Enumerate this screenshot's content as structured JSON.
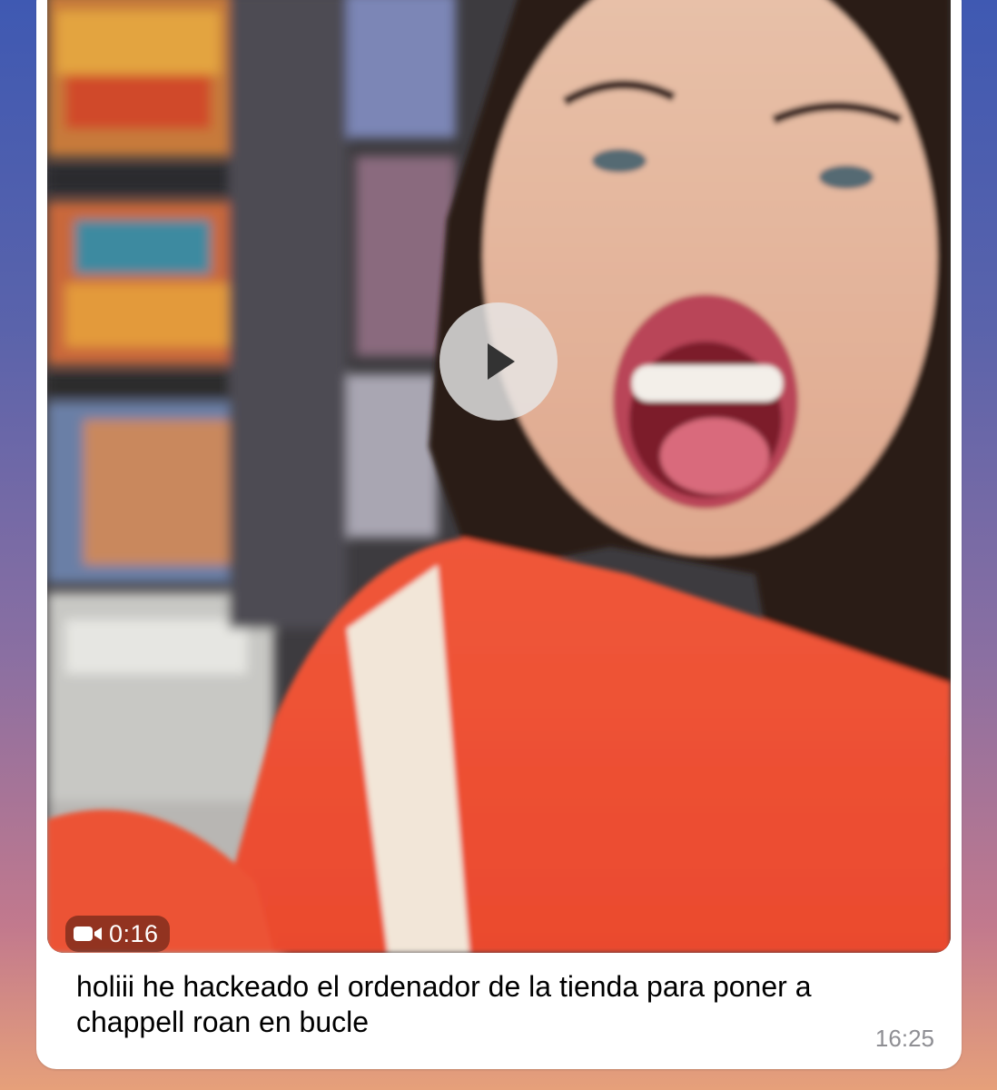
{
  "message": {
    "video": {
      "duration": "0:16",
      "duration_icon": "video-camera-icon",
      "play_icon": "play-icon"
    },
    "caption": "holiii he hackeado el ordenador de la tienda para poner a chappell roan en bucle",
    "timestamp": "16:25"
  },
  "colors": {
    "bubble": "#ffffff",
    "timestamp": "#8e8e93",
    "background_top": "#3f59b2",
    "background_bottom": "#e6a07a"
  }
}
